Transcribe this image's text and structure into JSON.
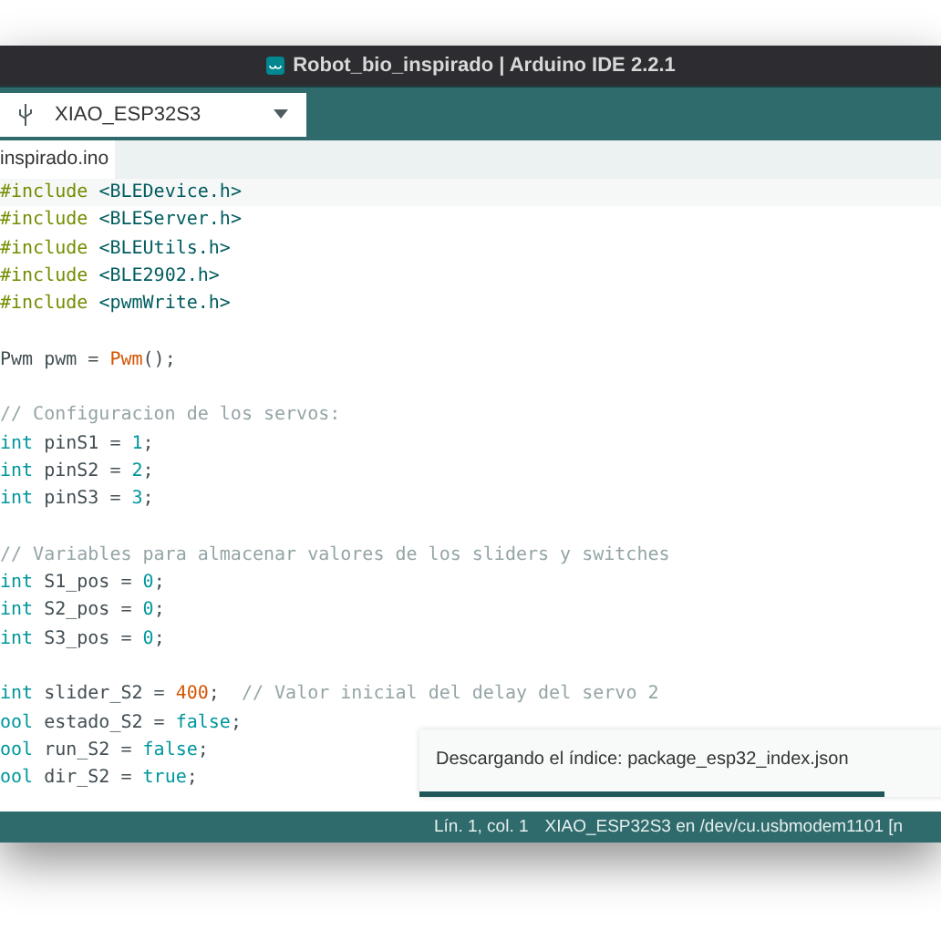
{
  "window": {
    "title": "Robot_bio_inspirado | Arduino IDE 2.2.1"
  },
  "toolbar": {
    "board": "XIAO_ESP32S3"
  },
  "tabs": [
    {
      "label": "inspirado.ino",
      "selected": true
    }
  ],
  "code": [
    {
      "tokens": [
        {
          "kind": "directive",
          "text": "#include"
        },
        {
          "kind": "header",
          "text": " <BLEDevice.h>"
        }
      ]
    },
    {
      "tokens": [
        {
          "kind": "directive",
          "text": "#include"
        },
        {
          "kind": "header",
          "text": " <BLEServer.h>"
        }
      ]
    },
    {
      "tokens": [
        {
          "kind": "directive",
          "text": "#include"
        },
        {
          "kind": "header",
          "text": " <BLEUtils.h>"
        }
      ]
    },
    {
      "tokens": [
        {
          "kind": "directive",
          "text": "#include"
        },
        {
          "kind": "header",
          "text": " <BLE2902.h>"
        }
      ]
    },
    {
      "tokens": [
        {
          "kind": "directive",
          "text": "#include"
        },
        {
          "kind": "header",
          "text": " <pwmWrite.h>"
        }
      ]
    },
    {
      "blank_before": true,
      "tokens": [
        {
          "kind": "plain",
          "text": "Pwm pwm = "
        },
        {
          "kind": "function",
          "text": "Pwm"
        },
        {
          "kind": "plain",
          "text": "();"
        }
      ]
    },
    {
      "blank_before": true,
      "tokens": [
        {
          "kind": "comment",
          "text": "// Configuracion de los servos:"
        }
      ]
    },
    {
      "tokens": [
        {
          "kind": "keyword",
          "text": "int"
        },
        {
          "kind": "plain",
          "text": " pinS1 = "
        },
        {
          "kind": "keyword",
          "text": "1"
        },
        {
          "kind": "plain",
          "text": ";"
        }
      ]
    },
    {
      "tokens": [
        {
          "kind": "keyword",
          "text": "int"
        },
        {
          "kind": "plain",
          "text": " pinS2 = "
        },
        {
          "kind": "keyword",
          "text": "2"
        },
        {
          "kind": "plain",
          "text": ";"
        }
      ]
    },
    {
      "tokens": [
        {
          "kind": "keyword",
          "text": "int"
        },
        {
          "kind": "plain",
          "text": " pinS3 = "
        },
        {
          "kind": "keyword",
          "text": "3"
        },
        {
          "kind": "plain",
          "text": ";"
        }
      ]
    },
    {
      "blank_before": true,
      "tokens": [
        {
          "kind": "comment",
          "text": "// Variables para almacenar valores de los sliders y switches"
        }
      ]
    },
    {
      "tokens": [
        {
          "kind": "keyword",
          "text": "int"
        },
        {
          "kind": "plain",
          "text": " S1_pos = "
        },
        {
          "kind": "keyword",
          "text": "0"
        },
        {
          "kind": "plain",
          "text": ";"
        }
      ]
    },
    {
      "tokens": [
        {
          "kind": "keyword",
          "text": "int"
        },
        {
          "kind": "plain",
          "text": " S2_pos = "
        },
        {
          "kind": "keyword",
          "text": "0"
        },
        {
          "kind": "plain",
          "text": ";"
        }
      ]
    },
    {
      "tokens": [
        {
          "kind": "keyword",
          "text": "int"
        },
        {
          "kind": "plain",
          "text": " S3_pos = "
        },
        {
          "kind": "keyword",
          "text": "0"
        },
        {
          "kind": "plain",
          "text": ";"
        }
      ]
    },
    {
      "blank_before": true,
      "tokens": [
        {
          "kind": "keyword",
          "text": "int"
        },
        {
          "kind": "plain",
          "text": " slider_S2 = "
        },
        {
          "kind": "function",
          "text": "400"
        },
        {
          "kind": "plain",
          "text": ";"
        },
        {
          "kind": "comment",
          "text": "  // Valor inicial del delay del servo 2"
        }
      ]
    },
    {
      "tokens": [
        {
          "kind": "keyword",
          "text": "ool"
        },
        {
          "kind": "plain",
          "text": " estado_S2 = "
        },
        {
          "kind": "keyword",
          "text": "false"
        },
        {
          "kind": "plain",
          "text": ";"
        }
      ]
    },
    {
      "tokens": [
        {
          "kind": "keyword",
          "text": "ool"
        },
        {
          "kind": "plain",
          "text": " run_S2 = "
        },
        {
          "kind": "keyword",
          "text": "false"
        },
        {
          "kind": "plain",
          "text": ";"
        }
      ]
    },
    {
      "tokens": [
        {
          "kind": "keyword",
          "text": "ool"
        },
        {
          "kind": "plain",
          "text": " dir_S2 = "
        },
        {
          "kind": "keyword",
          "text": "true"
        },
        {
          "kind": "plain",
          "text": ";"
        }
      ]
    }
  ],
  "notification": {
    "message": "Descargando el índice: package_esp32_index.json",
    "level": 0.85
  },
  "status_bar": {
    "position": "Lín. 1, col. 1",
    "board": "XIAO_ESP32S3 en /dev/cu.usbmodem1101 [n"
  }
}
